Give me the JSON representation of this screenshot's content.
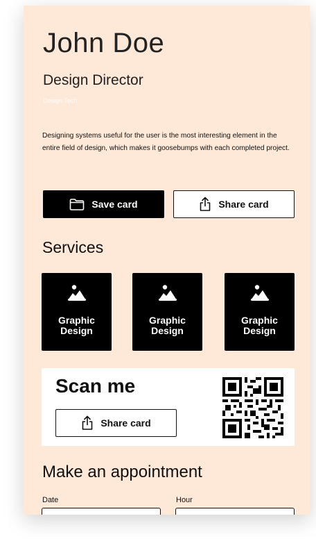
{
  "profile": {
    "name": "John Doe",
    "title": "Design Director",
    "company": "Design Tech",
    "bio": "Designing systems useful for the user is the most interesting element in the entire field of design, which makes it goosebumps with each completed project."
  },
  "actions": {
    "save_label": "Save card",
    "share_label": "Share card"
  },
  "services": {
    "heading": "Services",
    "items": [
      {
        "label": "Graphic Design",
        "icon": "image-icon"
      },
      {
        "label": "Graphic Design",
        "icon": "image-icon"
      },
      {
        "label": "Graphic Design",
        "icon": "image-icon"
      }
    ]
  },
  "scan": {
    "heading": "Scan me",
    "share_label": "Share card",
    "qr_icon": "qr-code-icon"
  },
  "appointment": {
    "heading_light": "Make an",
    "heading_bold": "appointment",
    "date_label": "Date",
    "hour_label": "Hour"
  },
  "colors": {
    "background": "#fee8d7",
    "primary": "#000000",
    "surface": "#ffffff"
  }
}
